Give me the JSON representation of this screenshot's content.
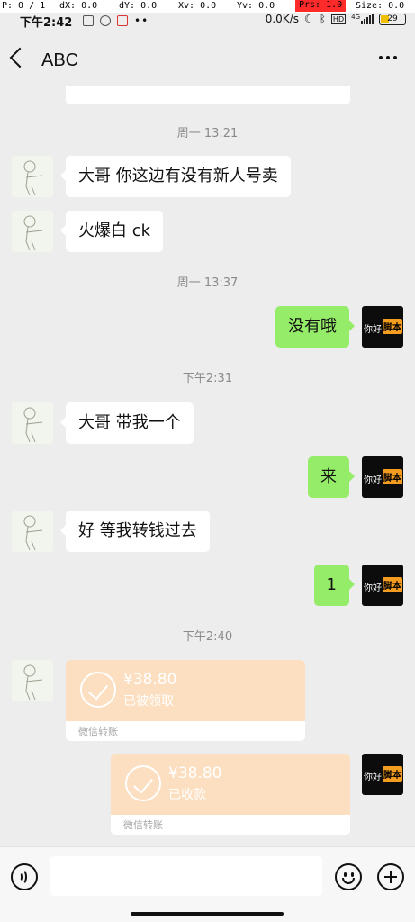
{
  "debug": {
    "p": "P: 0 / 1",
    "dx": "dX: 0.0",
    "dy": "dY: 0.0",
    "xv": "Xv: 0.0",
    "yv": "Yv: 0.0",
    "prs": "Prs: 1.0",
    "size": "Size: 0.0"
  },
  "status": {
    "time": "下午2:42",
    "speed": "0.0K/s",
    "battery": "29",
    "network": "4G",
    "hd": "HD"
  },
  "header": {
    "title": "ABC"
  },
  "chat": {
    "timestamps": [
      "周一 13:21",
      "周一 13:37",
      "下午2:31",
      "下午2:40"
    ],
    "messages": [
      {
        "from": "them",
        "text": "大哥 你这边有没有新人号卖"
      },
      {
        "from": "them",
        "text": "火爆白 ck"
      },
      {
        "from": "me",
        "text": "没有哦"
      },
      {
        "from": "them",
        "text": "大哥  带我一个"
      },
      {
        "from": "me",
        "text": "来"
      },
      {
        "from": "them",
        "text": "好  等我转钱过去"
      },
      {
        "from": "me",
        "text": "1"
      }
    ],
    "transfers": [
      {
        "from": "them",
        "amount": "¥38.80",
        "status": "已被领取",
        "label": "微信转账"
      },
      {
        "from": "me",
        "amount": "¥38.80",
        "status": "已收款",
        "label": "微信转账"
      }
    ],
    "my_avatar": {
      "text_left": "你好",
      "text_badge": "脚本"
    }
  },
  "colors": {
    "bg": "#ededed",
    "out_bubble": "#95ec69",
    "in_bubble": "#ffffff",
    "transfer": "#fbdfc0"
  }
}
